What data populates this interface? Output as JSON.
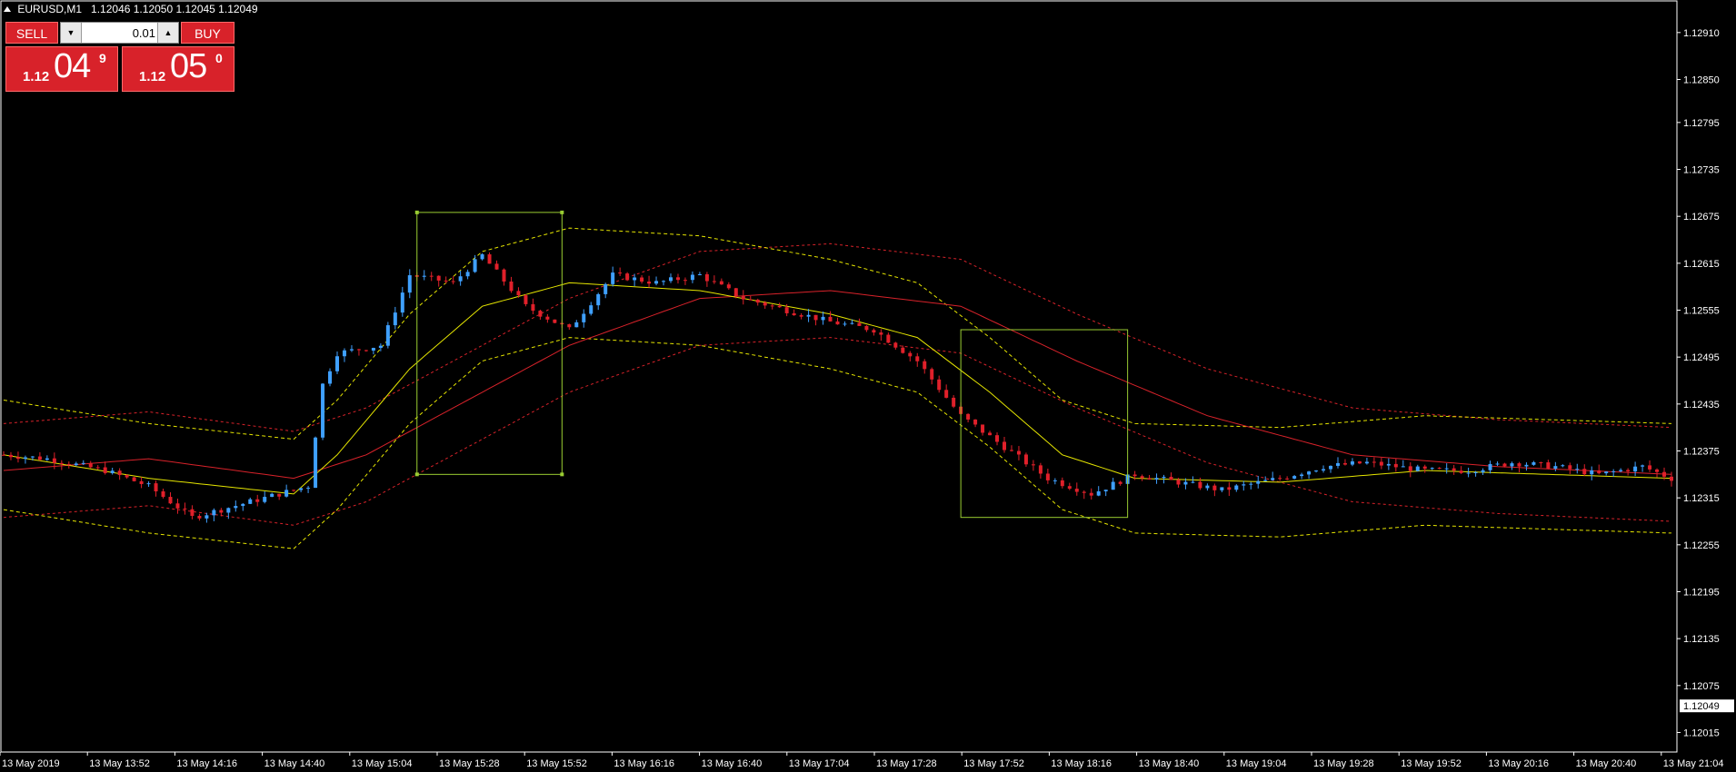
{
  "header": {
    "symbol": "EURUSD,M1",
    "ohlc": "1.12046 1.12050 1.12045 1.12049"
  },
  "trade_panel": {
    "sell_label": "SELL",
    "buy_label": "BUY",
    "lot_value": "0.01",
    "sell_price_small": "1.12",
    "sell_price_big": "04",
    "sell_price_sup": "9",
    "buy_price_small": "1.12",
    "buy_price_big": "05",
    "buy_price_sup": "0"
  },
  "colors": {
    "background": "#000000",
    "axis": "#ffffff",
    "bull": "#3fa0ff",
    "bear": "#e0202a",
    "ma_fast": "#e5e500",
    "ma_slow": "#d8222a",
    "box": "#9acd32",
    "panel": "#d8222a"
  },
  "chart_data": {
    "type": "candlestick",
    "ylim": [
      1.1199,
      1.1294
    ],
    "price_ticks": [
      "1.12910",
      "1.12850",
      "1.12795",
      "1.12735",
      "1.12675",
      "1.12615",
      "1.12555",
      "1.12495",
      "1.12435",
      "1.12375",
      "1.12315",
      "1.12255",
      "1.12195",
      "1.12135",
      "1.12075",
      "1.12015"
    ],
    "current_price": "1.12049",
    "time_labels": [
      "13 May 2019",
      "13 May 13:52",
      "13 May 14:16",
      "13 May 14:40",
      "13 May 15:04",
      "13 May 15:28",
      "13 May 15:52",
      "13 May 16:16",
      "13 May 16:40",
      "13 May 17:04",
      "13 May 17:28",
      "13 May 17:52",
      "13 May 18:16",
      "13 May 18:40",
      "13 May 19:04",
      "13 May 19:28",
      "13 May 19:52",
      "13 May 20:16",
      "13 May 20:40",
      "13 May 21:04"
    ],
    "close_path": [
      [
        0,
        1.1237
      ],
      [
        6,
        1.12365
      ],
      [
        14,
        1.1235
      ],
      [
        20,
        1.1233
      ],
      [
        26,
        1.1229
      ],
      [
        32,
        1.12305
      ],
      [
        38,
        1.1232
      ],
      [
        42,
        1.1233
      ],
      [
        44,
        1.1246
      ],
      [
        46,
        1.125
      ],
      [
        52,
        1.1251
      ],
      [
        56,
        1.126
      ],
      [
        62,
        1.1259
      ],
      [
        66,
        1.12625
      ],
      [
        72,
        1.1256
      ],
      [
        78,
        1.1253
      ],
      [
        84,
        1.126
      ],
      [
        90,
        1.1259
      ],
      [
        96,
        1.126
      ],
      [
        102,
        1.1257
      ],
      [
        108,
        1.12555
      ],
      [
        114,
        1.1254
      ],
      [
        120,
        1.1253
      ],
      [
        126,
        1.1249
      ],
      [
        132,
        1.1242
      ],
      [
        138,
        1.1238
      ],
      [
        144,
        1.1234
      ],
      [
        150,
        1.1232
      ],
      [
        156,
        1.12345
      ],
      [
        162,
        1.12335
      ],
      [
        168,
        1.12325
      ],
      [
        176,
        1.1234
      ],
      [
        182,
        1.12355
      ],
      [
        188,
        1.1236
      ],
      [
        196,
        1.1235
      ],
      [
        202,
        1.1235
      ],
      [
        208,
        1.1236
      ],
      [
        214,
        1.12355
      ],
      [
        220,
        1.12345
      ],
      [
        226,
        1.12355
      ],
      [
        230,
        1.1234
      ]
    ],
    "ma_fast": [
      [
        0,
        1.1237
      ],
      [
        20,
        1.1234
      ],
      [
        40,
        1.1232
      ],
      [
        46,
        1.1237
      ],
      [
        56,
        1.1248
      ],
      [
        66,
        1.1256
      ],
      [
        78,
        1.1259
      ],
      [
        96,
        1.1258
      ],
      [
        114,
        1.1255
      ],
      [
        126,
        1.1252
      ],
      [
        136,
        1.1245
      ],
      [
        146,
        1.1237
      ],
      [
        156,
        1.1234
      ],
      [
        176,
        1.12335
      ],
      [
        196,
        1.1235
      ],
      [
        230,
        1.1234
      ]
    ],
    "ma_slow": [
      [
        0,
        1.1235
      ],
      [
        20,
        1.12365
      ],
      [
        40,
        1.1234
      ],
      [
        50,
        1.1237
      ],
      [
        62,
        1.1243
      ],
      [
        78,
        1.1251
      ],
      [
        96,
        1.1257
      ],
      [
        114,
        1.1258
      ],
      [
        132,
        1.1256
      ],
      [
        148,
        1.1249
      ],
      [
        166,
        1.1242
      ],
      [
        186,
        1.1237
      ],
      [
        206,
        1.12355
      ],
      [
        230,
        1.12345
      ]
    ],
    "boxes": [
      {
        "from_bar": 57,
        "to_bar": 77,
        "high": 1.1268,
        "low": 1.12345
      },
      {
        "from_bar": 132,
        "to_bar": 155,
        "high": 1.1253,
        "low": 1.1229
      }
    ]
  }
}
